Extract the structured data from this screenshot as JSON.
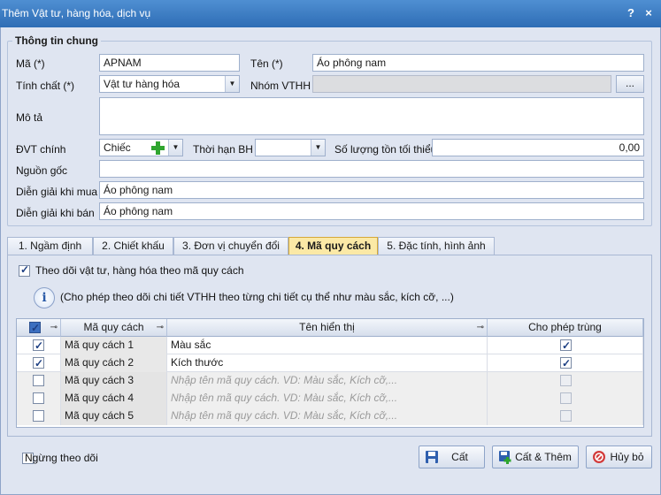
{
  "window": {
    "title": "Thêm Vật tư, hàng hóa, dịch vụ",
    "help_label": "?",
    "close_label": "×"
  },
  "general": {
    "group_title": "Thông tin chung",
    "code_label": "Mã (*)",
    "code_value": "APNAM",
    "name_label": "Tên (*)",
    "name_value": "Áo phông nam",
    "nature_label": "Tính chất (*)",
    "nature_value": "Vật tư hàng hóa",
    "group_label": "Nhóm VTHH",
    "group_value": "",
    "browse_label": "...",
    "desc_label": "Mô tả",
    "desc_value": "",
    "unit_label": "ĐVT chính",
    "unit_value": "Chiếc",
    "warranty_label": "Thời hạn BH",
    "warranty_value": "",
    "min_stock_label": "Số lượng tồn tối thiểu",
    "min_stock_value": "0,00",
    "origin_label": "Nguồn gốc",
    "origin_value": "",
    "buy_desc_label": "Diễn giải khi mua",
    "buy_desc_value": "Áo phông nam",
    "sell_desc_label": "Diễn giải khi bán",
    "sell_desc_value": "Áo phông nam"
  },
  "tabs": [
    {
      "label": "1. Ngầm định"
    },
    {
      "label": "2. Chiết khấu"
    },
    {
      "label": "3. Đơn vị chuyển đổi"
    },
    {
      "label": "4. Mã quy cách"
    },
    {
      "label": "5. Đặc tính, hình ảnh"
    }
  ],
  "spec_tab": {
    "track_label": "Theo dõi vật tư, hàng hóa theo mã quy cách",
    "track_checked": true,
    "info_text": "(Cho phép theo dõi chi tiết VTHH theo từng chi tiết cụ thể như màu sắc, kích cỡ, ...)",
    "info_icon_glyph": "i",
    "columns": {
      "code": "Mã quy cách",
      "display": "Tên hiển thị",
      "allow_dup": "Cho phép trùng"
    },
    "pin_glyph": "⊸",
    "rows": [
      {
        "checked": true,
        "code": "Mã quy cách 1",
        "display": "Màu sắc",
        "placeholder": false,
        "dup": true
      },
      {
        "checked": true,
        "code": "Mã quy cách 2",
        "display": "Kích thước",
        "placeholder": false,
        "dup": true
      },
      {
        "checked": false,
        "code": "Mã quy cách 3",
        "display": "Nhập tên mã quy cách. VD: Màu sắc, Kích cỡ,...",
        "placeholder": true,
        "dup": false
      },
      {
        "checked": false,
        "code": "Mã quy cách 4",
        "display": "Nhập tên mã quy cách. VD: Màu sắc, Kích cỡ,...",
        "placeholder": true,
        "dup": false
      },
      {
        "checked": false,
        "code": "Mã quy cách 5",
        "display": "Nhập tên mã quy cách. VD: Màu sắc, Kích cỡ,...",
        "placeholder": true,
        "dup": false
      }
    ]
  },
  "footer": {
    "stop_tracking_label": "Ngừng theo dõi",
    "save_label": "Cất",
    "save_add_label": "Cất & Thêm",
    "cancel_label": "Hủy bỏ"
  },
  "colors": {
    "titlebar": "#3b7cc4",
    "active_tab": "#fbe9a6",
    "plus_icon": "#2fa52f",
    "cancel_icon": "#d23b3b"
  }
}
